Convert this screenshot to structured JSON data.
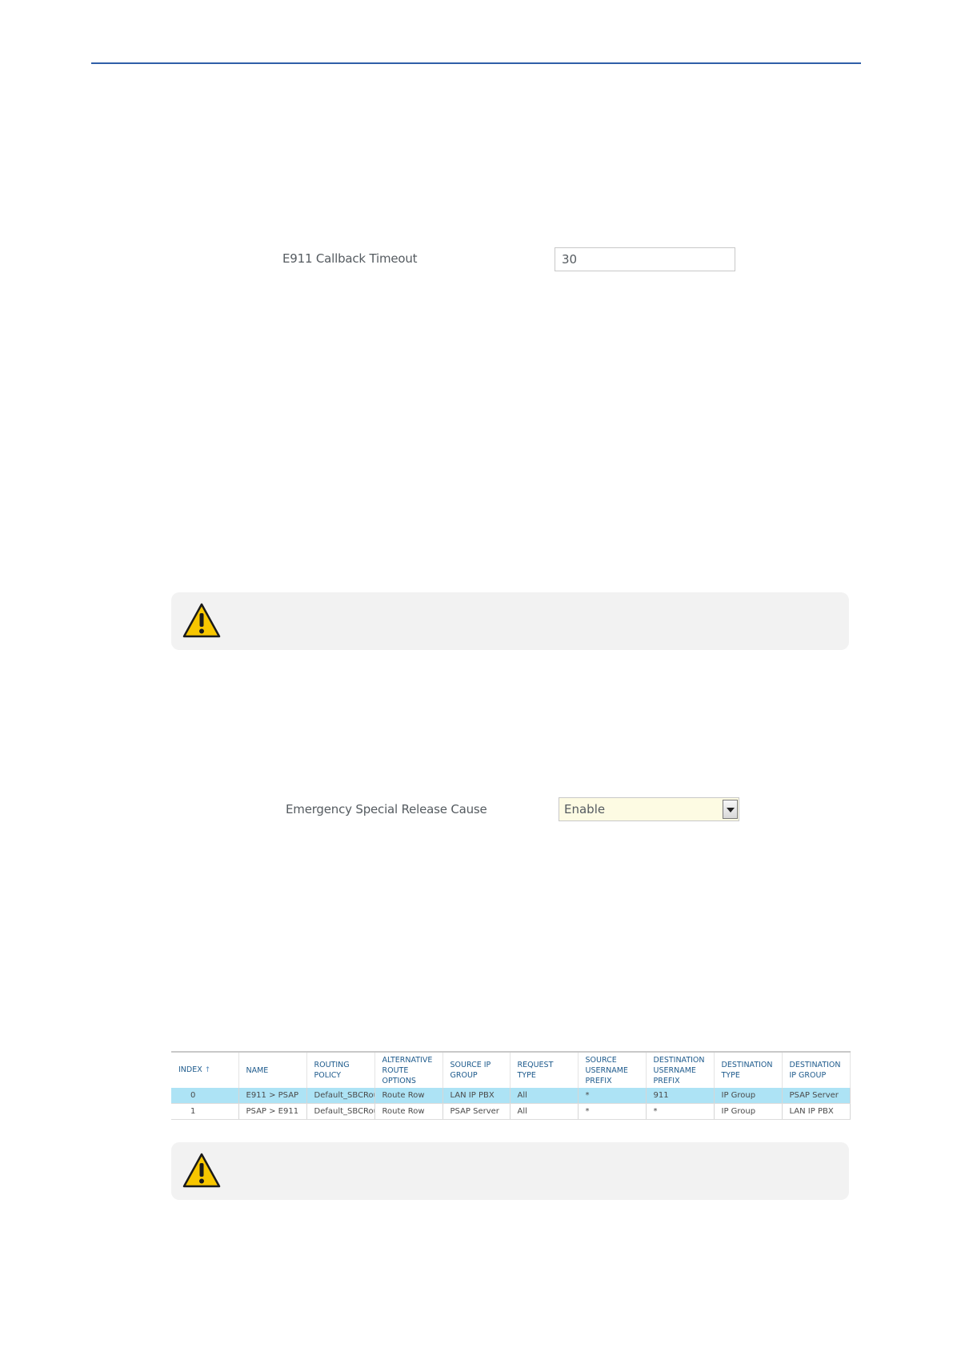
{
  "callback": {
    "label": "E911 Callback Timeout",
    "value": "30"
  },
  "release_cause": {
    "label": "Emergency Special Release Cause",
    "selected": "Enable"
  },
  "routing_table": {
    "columns": [
      "INDEX",
      "NAME",
      "ROUTING POLICY",
      "ALTERNATIVE ROUTE OPTIONS",
      "SOURCE IP GROUP",
      "REQUEST TYPE",
      "SOURCE USERNAME PREFIX",
      "DESTINATION USERNAME PREFIX",
      "DESTINATION TYPE",
      "DESTINATION IP GROUP"
    ],
    "sort_indicator": "↑",
    "rows": [
      [
        "0",
        "E911 > PSAP",
        "Default_SBCRou",
        "Route Row",
        "LAN IP PBX",
        "All",
        "*",
        "911",
        "IP Group",
        "PSAP Server"
      ],
      [
        "1",
        "PSAP > E911",
        "Default_SBCRou",
        "Route Row",
        "PSAP Server",
        "All",
        "*",
        "*",
        "IP Group",
        "LAN IP PBX"
      ]
    ]
  },
  "colors": {
    "header_rule": "#2f5fa8",
    "selected_row": "#ade3f5",
    "warning_fill": "#f7c600"
  },
  "icons": [
    "warning-icon",
    "warning-icon",
    "dropdown-arrow-icon",
    "sort-ascending-icon"
  ]
}
